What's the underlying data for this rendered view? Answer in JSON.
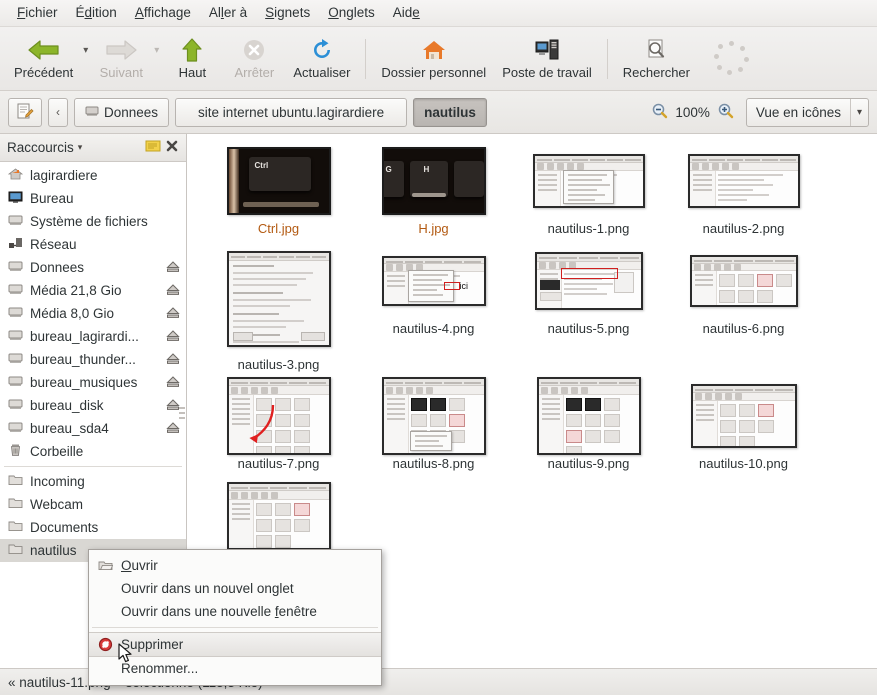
{
  "menubar": {
    "items": [
      {
        "label": "Fichier",
        "accel": "F"
      },
      {
        "label": "Édition",
        "accel": "d"
      },
      {
        "label": "Affichage",
        "accel": "A"
      },
      {
        "label": "Aller à",
        "accel": "l"
      },
      {
        "label": "Signets",
        "accel": "S"
      },
      {
        "label": "Onglets",
        "accel": "O"
      },
      {
        "label": "Aide",
        "accel": "e"
      }
    ]
  },
  "toolbar": {
    "back_label": "Précédent",
    "forward_label": "Suivant",
    "up_label": "Haut",
    "stop_label": "Arrêter",
    "reload_label": "Actualiser",
    "home_label": "Dossier personnel",
    "computer_label": "Poste de travail",
    "search_label": "Rechercher",
    "overflow_name": "toolbar-overflow-dots"
  },
  "pathbar": {
    "edit_location_icon": "edit-location-icon",
    "prev_crumb_icon": "chevron-left-icon",
    "crumbs": [
      {
        "label": "Donnees",
        "icon": "drive-icon",
        "active": false
      },
      {
        "label": "site internet ubuntu.lagirardiere",
        "icon": "",
        "active": false
      },
      {
        "label": "nautilus",
        "icon": "",
        "active": true
      }
    ],
    "zoom_out_icon": "zoom-out-icon",
    "zoom_level": "100%",
    "zoom_in_icon": "zoom-in-icon",
    "view_mode": "Vue en icônes"
  },
  "sidebar": {
    "title": "Raccourcis",
    "header_icon": "notes-icon",
    "close_icon": "close-icon",
    "items": [
      {
        "label": "lagirardiere",
        "icon": "home-folder-icon",
        "eject": false,
        "selected": false
      },
      {
        "label": "Bureau",
        "icon": "desktop-icon",
        "eject": false,
        "selected": false
      },
      {
        "label": "Système de fichiers",
        "icon": "drive-icon",
        "eject": false,
        "selected": false
      },
      {
        "label": "Réseau",
        "icon": "network-icon",
        "eject": false,
        "selected": false
      },
      {
        "label": "Donnees",
        "icon": "drive-icon",
        "eject": true,
        "selected": false
      },
      {
        "label": "Média 21,8 Gio",
        "icon": "drive-icon",
        "eject": true,
        "selected": false
      },
      {
        "label": "Média 8,0 Gio",
        "icon": "drive-icon",
        "eject": true,
        "selected": false
      },
      {
        "label": "bureau_lagirardi...",
        "icon": "drive-icon",
        "eject": true,
        "selected": false
      },
      {
        "label": "bureau_thunder...",
        "icon": "drive-icon",
        "eject": true,
        "selected": false
      },
      {
        "label": "bureau_musiques",
        "icon": "drive-icon",
        "eject": true,
        "selected": false
      },
      {
        "label": "bureau_disk",
        "icon": "drive-icon",
        "eject": true,
        "selected": false
      },
      {
        "label": "bureau_sda4",
        "icon": "drive-icon",
        "eject": true,
        "selected": false
      },
      {
        "label": "Corbeille",
        "icon": "trash-icon",
        "eject": false,
        "selected": false
      },
      {
        "separator": true
      },
      {
        "label": "Incoming",
        "icon": "folder-icon",
        "eject": false,
        "selected": false
      },
      {
        "label": "Webcam",
        "icon": "folder-icon",
        "eject": false,
        "selected": false
      },
      {
        "label": "Documents",
        "icon": "folder-icon",
        "eject": false,
        "selected": false
      },
      {
        "label": "nautilus",
        "icon": "folder-icon",
        "eject": false,
        "selected": true
      }
    ]
  },
  "files": [
    {
      "name": "Ctrl.jpg",
      "kind": "photo-key",
      "key": "Ctrl"
    },
    {
      "name": "H.jpg",
      "kind": "photo-key",
      "key": "H"
    },
    {
      "name": "nautilus-1.png",
      "kind": "screenshot-menu"
    },
    {
      "name": "nautilus-2.png",
      "kind": "screenshot-list"
    },
    {
      "name": "nautilus-3.png",
      "kind": "screenshot-dialog"
    },
    {
      "name": "nautilus-4.png",
      "kind": "screenshot-menu-annotated",
      "annotation": "ici"
    },
    {
      "name": "nautilus-5.png",
      "kind": "screenshot-redbox"
    },
    {
      "name": "nautilus-6.png",
      "kind": "screenshot-icons"
    },
    {
      "name": "nautilus-7.png",
      "kind": "screenshot-arrow"
    },
    {
      "name": "nautilus-8.png",
      "kind": "screenshot-icons-menu"
    },
    {
      "name": "nautilus-9.png",
      "kind": "screenshot-icons"
    },
    {
      "name": "nautilus-10.png",
      "kind": "screenshot-icons"
    },
    {
      "name": "nautilus-11.png",
      "kind": "screenshot-icons"
    }
  ],
  "context_menu": {
    "items": [
      {
        "label": "Ouvrir",
        "icon": "open-folder-icon",
        "accel": "O",
        "highlighted": false
      },
      {
        "label": "Ouvrir dans un nouvel onglet",
        "icon": "",
        "accel": "g",
        "highlighted": false
      },
      {
        "label": "Ouvrir dans une nouvelle fenêtre",
        "icon": "",
        "accel": "f",
        "highlighted": false
      },
      {
        "separator": true
      },
      {
        "label": "Supprimer",
        "icon": "forbidden-icon",
        "accel": "",
        "highlighted": true
      },
      {
        "label": "Renommer...",
        "icon": "",
        "accel": "",
        "highlighted": false
      }
    ]
  },
  "statusbar": {
    "text": "« nautilus-11.png » sélectionné (113,3 Kio)"
  },
  "colors": {
    "accent_orange": "#b35a12",
    "selection_grey": "#d9d7d3",
    "toolbar_bg": "#eceae8",
    "pane_bg": "#ffffff",
    "red_annotation": "#d02020"
  }
}
